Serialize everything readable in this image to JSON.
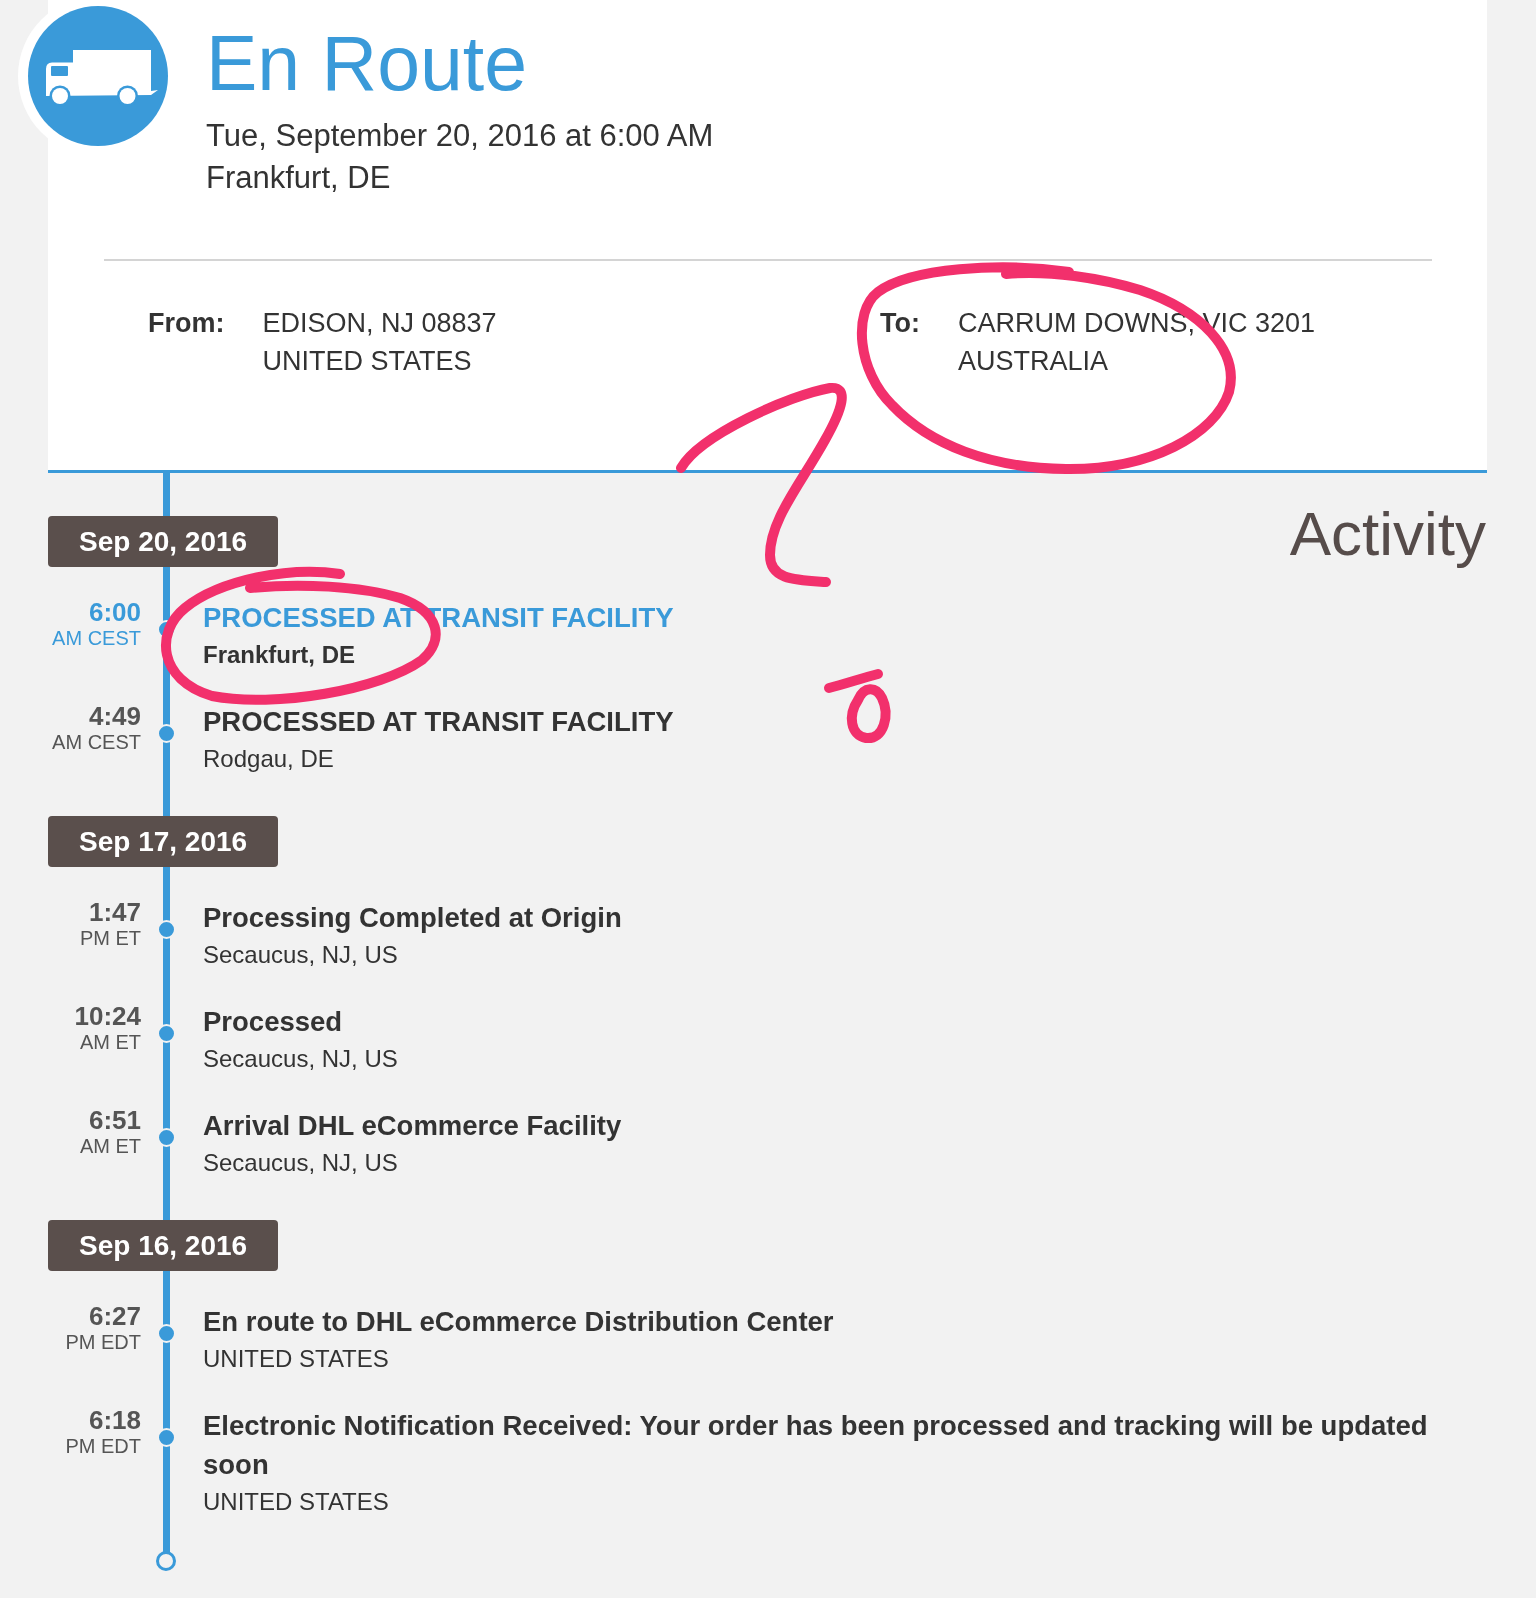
{
  "summary": {
    "status": "En Route",
    "date": "Tue, September 20, 2016 at 6:00 AM",
    "location": "Frankfurt, DE"
  },
  "addresses": [
    {
      "label": "From:",
      "lines": [
        "EDISON, NJ 08837",
        "UNITED STATES"
      ]
    },
    {
      "label": "To:",
      "lines": [
        "CARRUM DOWNS, VIC 3201",
        "AUSTRALIA"
      ]
    }
  ],
  "activity": {
    "heading": "Activity",
    "days": [
      {
        "date": "Sep 20, 2016",
        "events": [
          {
            "time": "6:00",
            "zone": "AM CEST",
            "title": "PROCESSED AT TRANSIT FACILITY",
            "location": "Frankfurt, DE",
            "highlighted": true
          },
          {
            "time": "4:49",
            "zone": "AM CEST",
            "title": "PROCESSED AT TRANSIT FACILITY",
            "location": "Rodgau, DE",
            "highlighted": false
          }
        ]
      },
      {
        "date": "Sep 17, 2016",
        "events": [
          {
            "time": "1:47",
            "zone": "PM ET",
            "title": "Processing Completed at Origin",
            "location": "Secaucus, NJ, US",
            "highlighted": false
          },
          {
            "time": "10:24",
            "zone": "AM ET",
            "title": "Processed",
            "location": "Secaucus, NJ, US",
            "highlighted": false
          },
          {
            "time": "6:51",
            "zone": "AM ET",
            "title": "Arrival DHL eCommerce Facility",
            "location": "Secaucus, NJ, US",
            "highlighted": false
          }
        ]
      },
      {
        "date": "Sep 16, 2016",
        "events": [
          {
            "time": "6:27",
            "zone": "PM EDT",
            "title": "En route to DHL eCommerce Distribution Center",
            "location": "UNITED STATES",
            "highlighted": false
          },
          {
            "time": "6:18",
            "zone": "PM EDT",
            "title": "Electronic Notification Received: Your order has been processed and tracking will be updated soon",
            "location": "UNITED STATES",
            "highlighted": false
          }
        ]
      }
    ]
  }
}
